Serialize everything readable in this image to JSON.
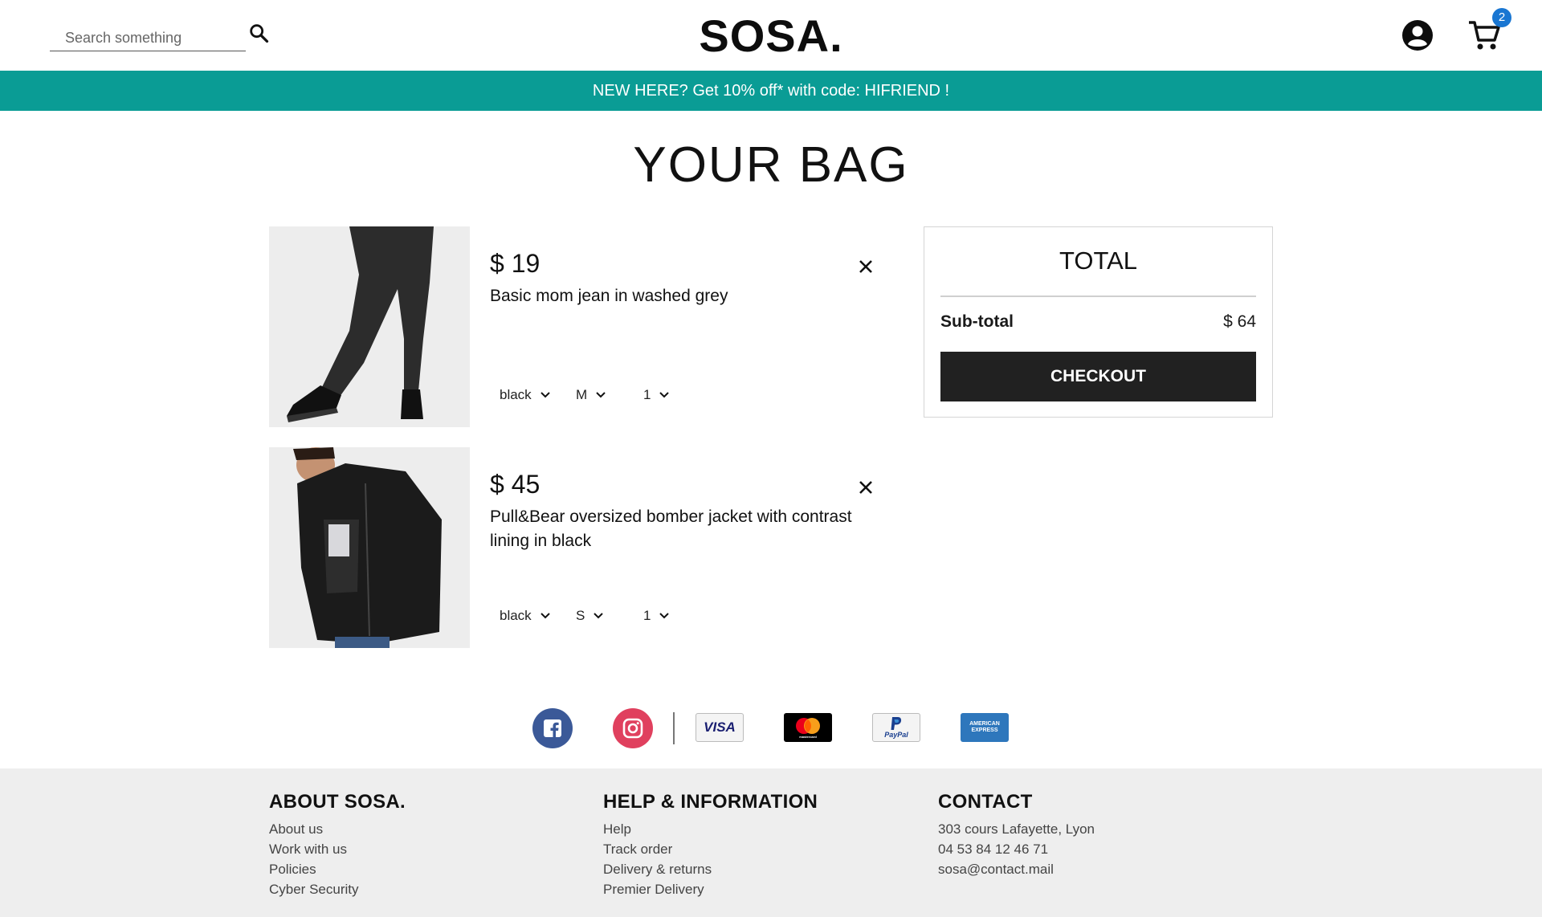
{
  "header": {
    "search_placeholder": "Search something",
    "logo": "SOSA.",
    "cart_count": "2"
  },
  "promo": {
    "text": "NEW HERE? Get 10% off* with code: HIFRIEND !"
  },
  "page_title": "YOUR BAG",
  "cart_items": [
    {
      "price": "$ 19",
      "name": "Basic mom jean in washed grey",
      "color": "black",
      "size": "M",
      "quantity": "1"
    },
    {
      "price": "$ 45",
      "name": "Pull&Bear oversized bomber jacket with contrast lining in black",
      "color": "black",
      "size": "S",
      "quantity": "1"
    }
  ],
  "summary": {
    "title": "TOTAL",
    "subtotal_label": "Sub-total",
    "subtotal_value": "$ 64",
    "checkout_label": "CHECKOUT"
  },
  "payment_methods": {
    "visa": "VISA",
    "mastercard": "mastercard",
    "paypal": "PayPal",
    "amex": "AMERICAN EXPRESS"
  },
  "footer": {
    "about": {
      "title": "ABOUT SOSA.",
      "links": [
        "About us",
        "Work with us",
        "Policies",
        "Cyber Security"
      ]
    },
    "help": {
      "title": "HELP & INFORMATION",
      "links": [
        "Help",
        "Track order",
        "Delivery & returns",
        "Premier Delivery"
      ]
    },
    "contact": {
      "title": "CONTACT",
      "lines": [
        "303 cours Lafayette, Lyon",
        "04 53 84 12 46 71",
        "sosa@contact.mail"
      ]
    }
  },
  "colors": {
    "promo_bg": "#0a9c95",
    "checkout_bg": "#212121",
    "badge_bg": "#1976d2",
    "facebook": "#3b5998",
    "instagram": "#e0405e",
    "footer_bg": "#eeeeee"
  }
}
